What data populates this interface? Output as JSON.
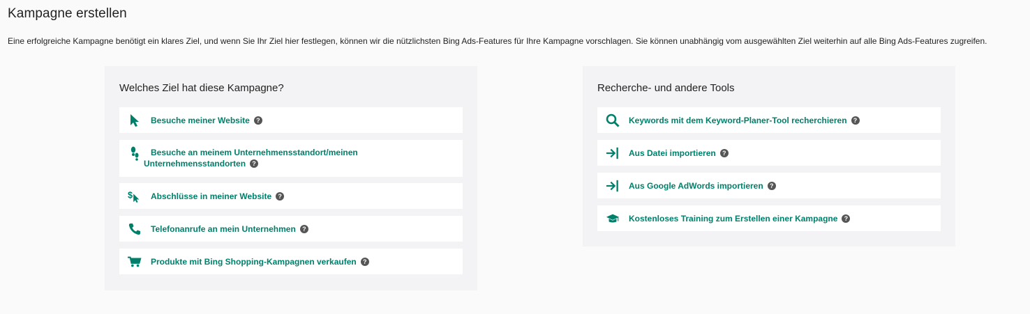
{
  "page": {
    "title": "Kampagne erstellen",
    "intro": "Eine erfolgreiche Kampagne benötigt ein klares Ziel, und wenn Sie Ihr Ziel hier festlegen, können wir die nützlichsten Bing Ads-Features für Ihre Kampagne vorschlagen. Sie können unabhängig vom ausgewählten Ziel weiterhin auf alle Bing Ads-Features zugreifen."
  },
  "goals": {
    "title": "Welches Ziel hat diese Kampagne?",
    "items": [
      {
        "label": "Besuche meiner Website",
        "icon": "cursor-icon"
      },
      {
        "label": "Besuche an meinem Unternehmensstandort/meinen Unternehmensstandorten",
        "icon": "footsteps-icon"
      },
      {
        "label": "Abschlüsse in meiner Website",
        "icon": "dollar-cursor-icon"
      },
      {
        "label": "Telefonanrufe an mein Unternehmen",
        "icon": "phone-icon"
      },
      {
        "label": "Produkte mit Bing Shopping-Kampagnen verkaufen",
        "icon": "cart-icon"
      }
    ]
  },
  "tools": {
    "title": "Recherche- und andere Tools",
    "items": [
      {
        "label": "Keywords mit dem Keyword-Planer-Tool recherchieren",
        "icon": "search-icon"
      },
      {
        "label": "Aus Datei importieren",
        "icon": "import-icon"
      },
      {
        "label": "Aus Google AdWords importieren",
        "icon": "import-icon"
      },
      {
        "label": "Kostenloses Training zum Erstellen einer Kampagne",
        "icon": "graduation-cap-icon"
      }
    ]
  },
  "help_glyph": "?",
  "colors": {
    "accent": "#00806b",
    "panel_bg": "#f3f2f4",
    "help_bg": "#555555"
  }
}
